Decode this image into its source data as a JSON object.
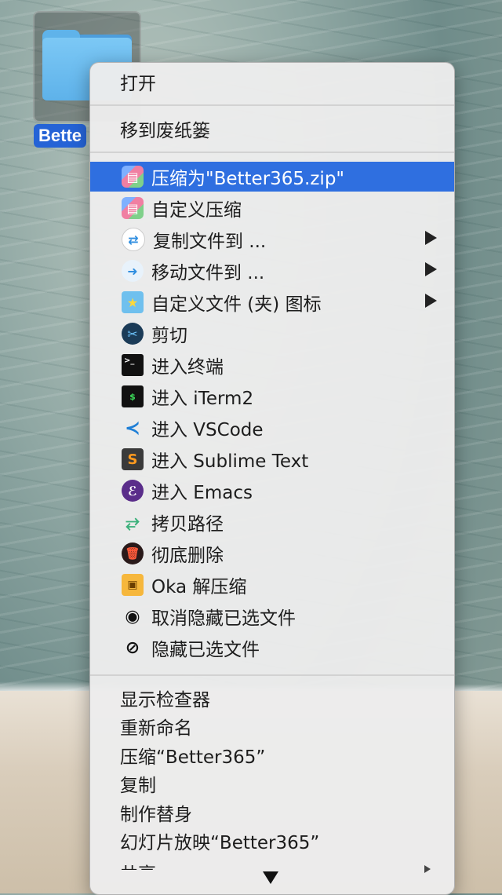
{
  "desktop": {
    "folder_label": "Bette"
  },
  "menu": {
    "top_items": [
      {
        "label": "打开"
      },
      {
        "label": "移到废纸篓"
      }
    ],
    "extension_items": [
      {
        "label": "压缩为\"Better365.zip\"",
        "icon": "archive-icon",
        "submenu": false,
        "active": true
      },
      {
        "label": "自定义压缩",
        "icon": "archive-icon",
        "submenu": false
      },
      {
        "label": "复制文件到 ...",
        "icon": "copy-to-icon",
        "submenu": true
      },
      {
        "label": "移动文件到 ...",
        "icon": "move-to-icon",
        "submenu": true
      },
      {
        "label": "自定义文件 (夹) 图标",
        "icon": "folder-star-icon",
        "submenu": true
      },
      {
        "label": "剪切",
        "icon": "scissors-icon",
        "submenu": false
      },
      {
        "label": "进入终端",
        "icon": "terminal-icon",
        "submenu": false
      },
      {
        "label": "进入 iTerm2",
        "icon": "iterm-icon",
        "submenu": false
      },
      {
        "label": "进入 VSCode",
        "icon": "vscode-icon",
        "submenu": false
      },
      {
        "label": "进入 Sublime Text",
        "icon": "sublime-icon",
        "submenu": false
      },
      {
        "label": "进入 Emacs",
        "icon": "emacs-icon",
        "submenu": false
      },
      {
        "label": "拷贝路径",
        "icon": "path-icon",
        "submenu": false
      },
      {
        "label": "彻底删除",
        "icon": "trash-icon",
        "submenu": false
      },
      {
        "label": "Oka 解压缩",
        "icon": "oka-icon",
        "submenu": false
      },
      {
        "label": "取消隐藏已选文件",
        "icon": "eye-icon",
        "submenu": false
      },
      {
        "label": "隐藏已选文件",
        "icon": "eye-slash-icon",
        "submenu": false
      }
    ],
    "bottom_items": [
      {
        "label": "显示检查器"
      },
      {
        "label": "重新命名"
      },
      {
        "label": "压缩“Better365”"
      },
      {
        "label": "复制"
      },
      {
        "label": "制作替身"
      },
      {
        "label": "幻灯片放映“Better365”"
      }
    ],
    "partial_item": "共享",
    "colors": {
      "highlight": "#2f6fe0",
      "menu_bg": "#ececec"
    }
  }
}
